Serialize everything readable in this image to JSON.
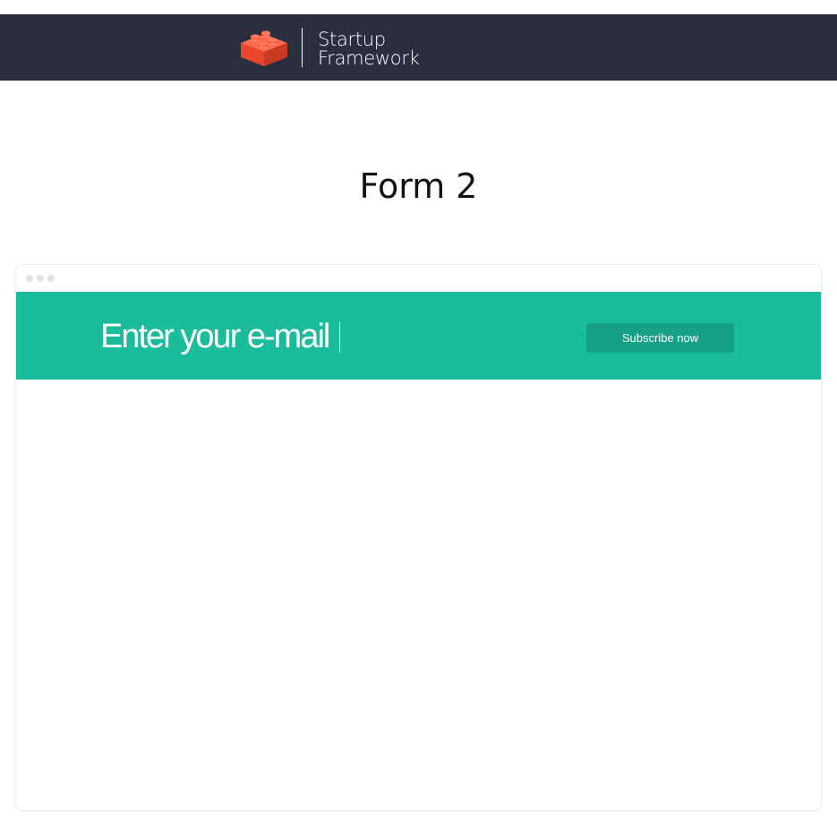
{
  "header": {
    "brand_line1": "Startup",
    "brand_line2": "Framework",
    "logo_icon": "lego-brick-icon",
    "background_color": "#2b2e3f",
    "logo_color": "#f05a38"
  },
  "page": {
    "title": "Form 2"
  },
  "preview": {
    "window_dots": [
      "dot",
      "dot",
      "dot"
    ],
    "band_color": "#1bbc9b",
    "email": {
      "placeholder": "Enter your e-mail",
      "value": ""
    },
    "subscribe_label": "Subscribe now",
    "button_color": "#16a085"
  }
}
